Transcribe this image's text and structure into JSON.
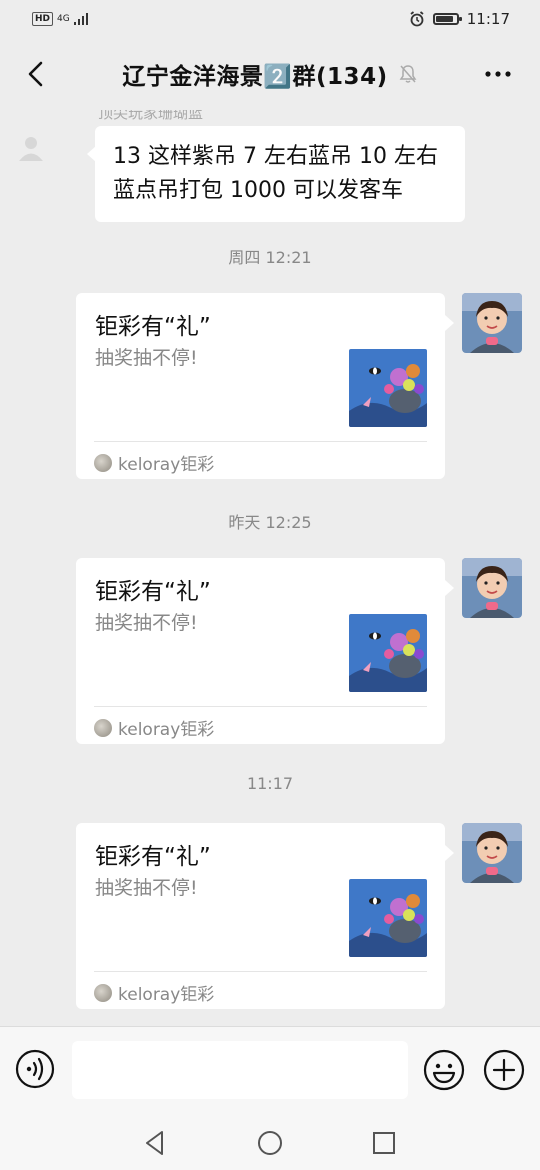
{
  "status_bar": {
    "hd_label": "HD",
    "network": "4G",
    "time": "11:17",
    "battery_level": 0.85
  },
  "header": {
    "title": "辽宁金洋海景2️⃣群(134)",
    "icons": {
      "back": "chevron-left-icon",
      "mute": "bell-muted-icon",
      "more": "more-dots-icon"
    }
  },
  "messages": [
    {
      "type": "text",
      "sender": "顶尖玩家珊瑚蓝",
      "text": "13 这样紫吊 7 左右蓝吊 10 左右蓝点吊打包 1000 可以发客车"
    },
    {
      "type": "time",
      "text": "周四 12:21"
    },
    {
      "type": "card",
      "title": "钜彩有“礼”",
      "description": "抽奖抽不停!",
      "source": "keloray钜彩"
    },
    {
      "type": "time",
      "text": "昨天 12:25"
    },
    {
      "type": "card",
      "title": "钜彩有“礼”",
      "description": "抽奖抽不停!",
      "source": "keloray钜彩"
    },
    {
      "type": "time",
      "text": "11:17"
    },
    {
      "type": "card",
      "title": "钜彩有“礼”",
      "description": "抽奖抽不停!",
      "source": "keloray钜彩"
    }
  ],
  "input_bar": {
    "message_value": "",
    "icons": {
      "voice": "voice-icon",
      "emoji": "emoji-icon",
      "plus": "plus-icon"
    }
  },
  "nav_bar": {
    "icons": [
      "nav-back-icon",
      "nav-home-icon",
      "nav-recents-icon"
    ]
  },
  "colors": {
    "background": "#ededed",
    "bubble": "#ffffff",
    "timestamp": "#888888"
  }
}
